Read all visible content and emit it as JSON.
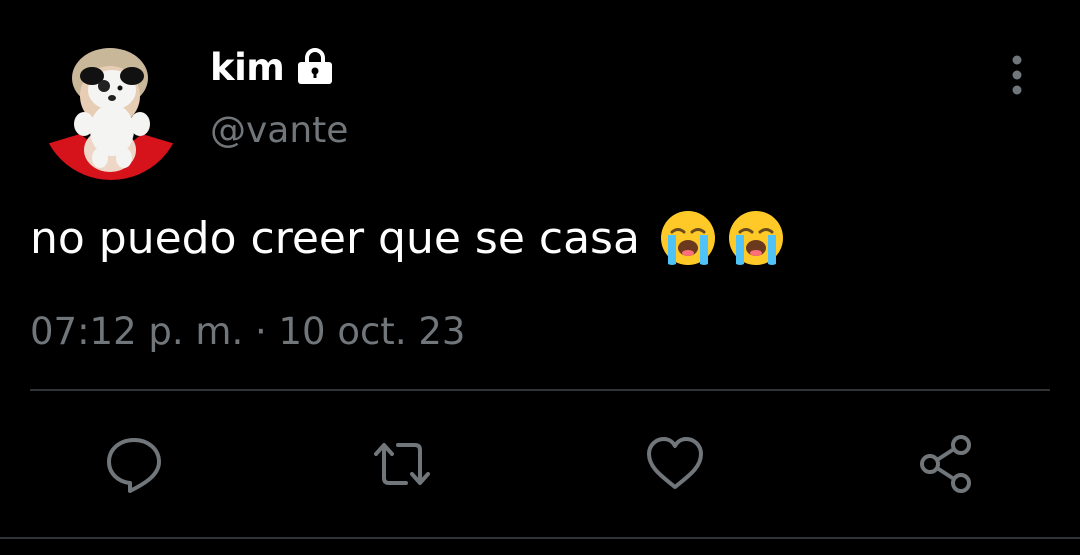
{
  "user": {
    "display_name": "kim",
    "handle": "@vante",
    "protected_icon": "lock-icon",
    "avatar_description_icon": "avatar"
  },
  "tweet": {
    "text": "no puedo creer que se casa",
    "emojis": [
      "loudly-crying-face",
      "loudly-crying-face"
    ],
    "timestamp": "07:12 p. m. · 10 oct. 23"
  },
  "actions": [
    {
      "name": "reply",
      "icon": "reply-icon"
    },
    {
      "name": "retweet",
      "icon": "retweet-icon"
    },
    {
      "name": "like",
      "icon": "heart-icon"
    },
    {
      "name": "share",
      "icon": "share-icon"
    }
  ],
  "menu": {
    "icon": "more-vertical-icon"
  },
  "colors": {
    "background": "#000000",
    "primary_text": "#ffffff",
    "secondary_text": "#71767b",
    "icon": "#71767b",
    "divider": "#2f3336",
    "avatar_accent": "#d6121b",
    "emoji_face": "#ffca28"
  }
}
